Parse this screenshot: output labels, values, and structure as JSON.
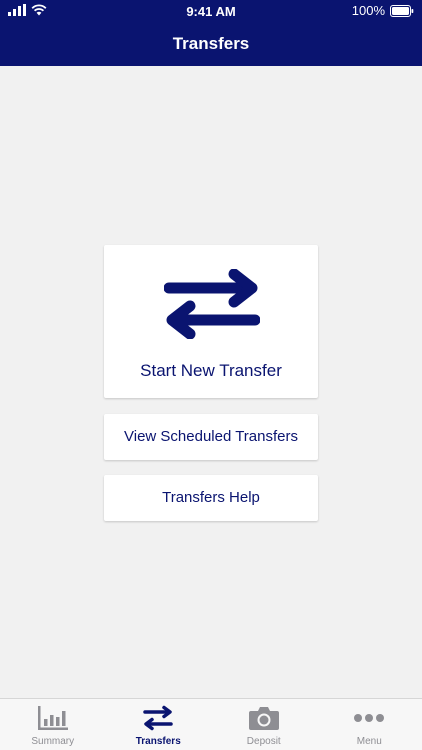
{
  "status_bar": {
    "time": "9:41 AM",
    "battery": "100%"
  },
  "header": {
    "title": "Transfers"
  },
  "actions": {
    "start_new": "Start New Transfer",
    "view_scheduled": "View Scheduled Transfers",
    "help": "Transfers Help"
  },
  "tabbar": {
    "tabs": [
      {
        "label": "Summary",
        "icon": "bar-chart-icon"
      },
      {
        "label": "Transfers",
        "icon": "transfer-arrows-icon"
      },
      {
        "label": "Deposit",
        "icon": "camera-icon"
      },
      {
        "label": "Menu",
        "icon": "more-dots-icon"
      }
    ],
    "active": "Transfers"
  },
  "colors": {
    "brand": "#0a1470",
    "background": "#f1f1f1",
    "inactive": "#8e8e93"
  }
}
